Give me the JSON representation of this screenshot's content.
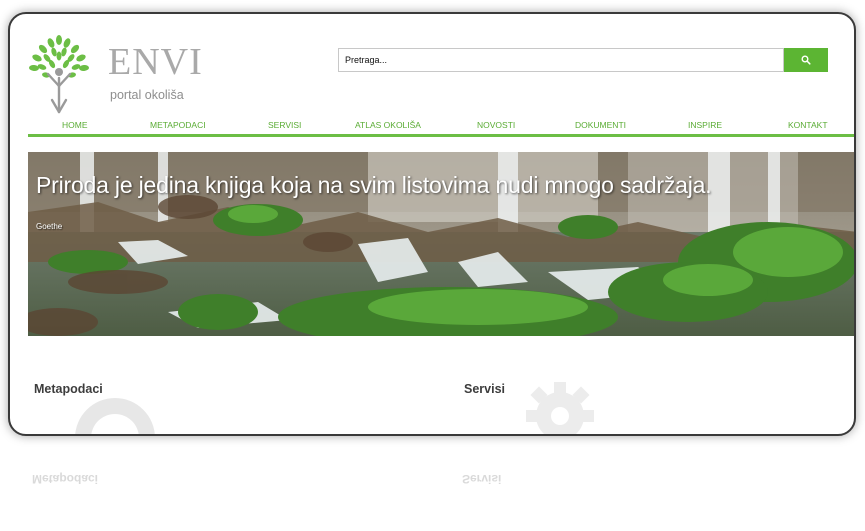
{
  "header": {
    "brand": "ENVI",
    "tagline": "portal okoliša"
  },
  "search": {
    "placeholder": "Pretraga...",
    "button_icon": "search-icon"
  },
  "nav": {
    "items": [
      "HOME",
      "METAPODACI",
      "SERVISI",
      "ATLAS OKOLIŠA",
      "NOVOSTI",
      "DOKUMENTI",
      "INSPIRE",
      "KONTAKT"
    ]
  },
  "hero": {
    "quote": "Priroda je jedina knjiga koja na svim listovima nudi mnogo sadržaja.",
    "author": "Goethe"
  },
  "sections": {
    "left_title": "Metapodaci",
    "right_title": "Servisi"
  },
  "colors": {
    "accent": "#5cb533",
    "nav_text": "#5aac34",
    "brand_grey": "#a9a9a9"
  }
}
